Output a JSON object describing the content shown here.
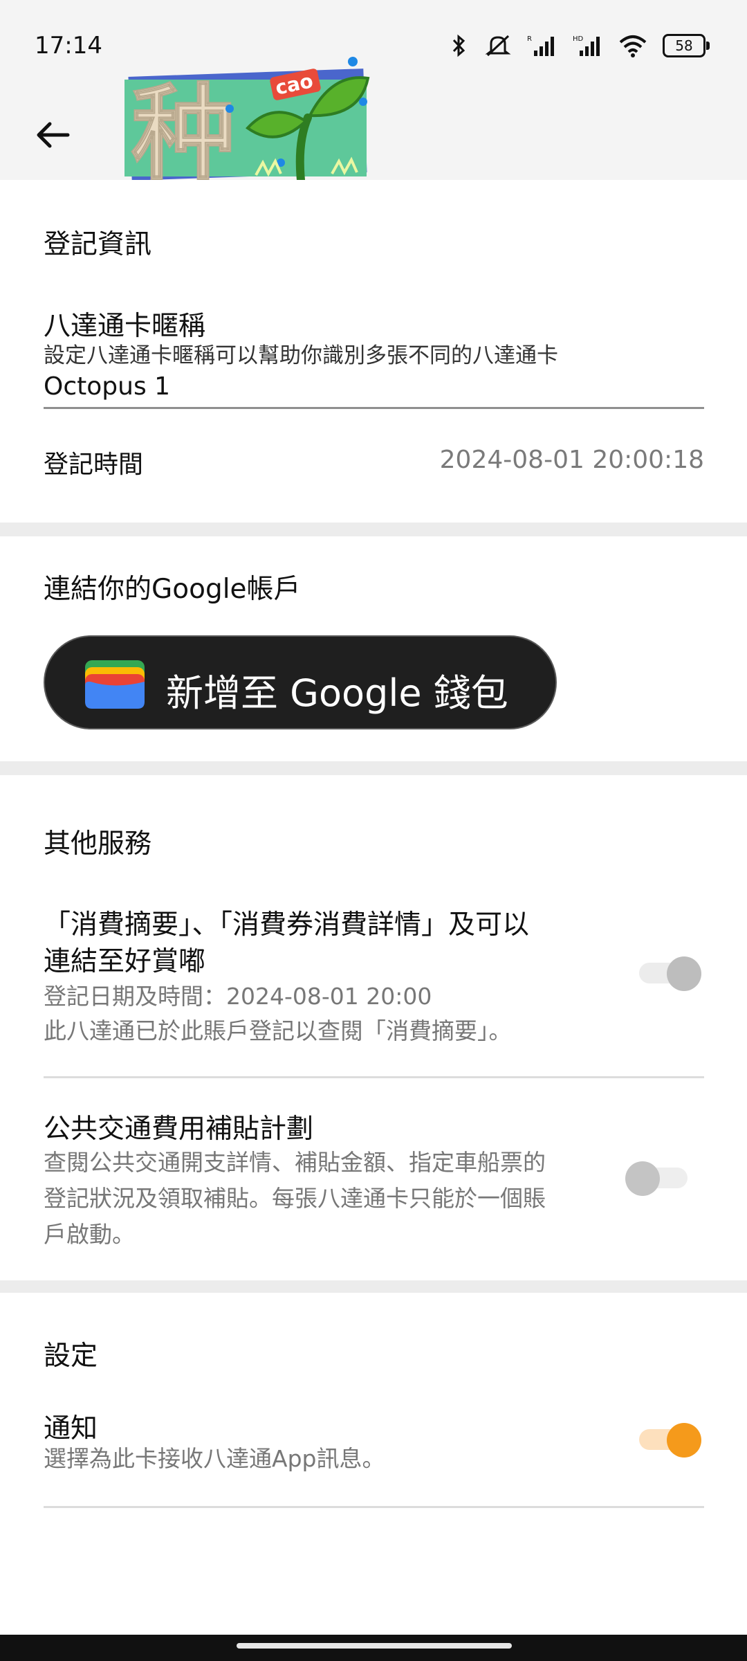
{
  "status_bar": {
    "time": "17:14",
    "battery": "58",
    "icons": [
      "bluetooth-icon",
      "mute-icon",
      "signal-r-icon",
      "signal-hd-icon",
      "wifi-icon",
      "battery-icon"
    ]
  },
  "app_bar": {
    "back_icon": "arrow-left-icon",
    "sticker_char": "种",
    "sticker_word": "cao"
  },
  "registration": {
    "title": "登記資訊",
    "nickname_label": "八達通卡暱稱",
    "nickname_desc": "設定八達通卡暱稱可以幫助你識別多張不同的八達通卡",
    "nickname_value": "Octopus 1",
    "time_label": "登記時間",
    "time_value": "2024-08-01 20:00:18"
  },
  "google": {
    "title": "連結你的Google帳戶",
    "button_label": "新增至 Google 錢包",
    "wallet_icon": "google-wallet-icon"
  },
  "services": {
    "title": "其他服務",
    "items": [
      {
        "title_line1": "「消費摘要」、「消費券消費詳情」及可以",
        "title_line2": "連結至好賞嘟",
        "desc_line1": "登記日期及時間：2024-08-01 20:00",
        "desc_line2": "此八達通已於此賬戶登記以查閱「消費摘要」。",
        "toggle": "on-disabled"
      },
      {
        "title_line1": "公共交通費用補貼計劃",
        "desc_line1": "查閱公共交通開支詳情、補貼金額、指定車船票的",
        "desc_line2": "登記狀況及領取補貼。每張八達通卡只能於一個賬",
        "desc_line3": "戶啟動。",
        "toggle": "off"
      }
    ]
  },
  "settings": {
    "title": "設定",
    "notify_label": "通知",
    "notify_desc": "選擇為此卡接收八達通App訊息。",
    "toggle": "on",
    "accent_color": "#f59a1b"
  }
}
